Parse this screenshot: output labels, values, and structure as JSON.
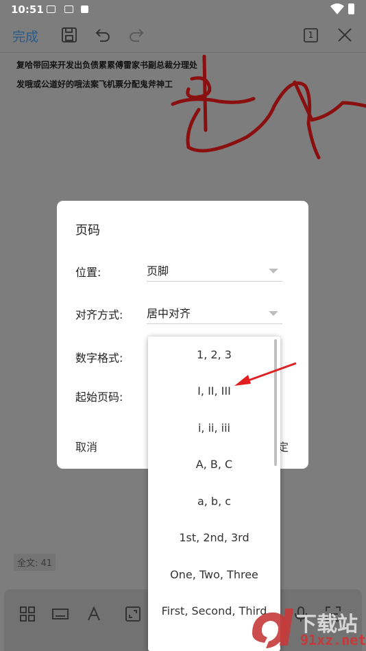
{
  "status_bar": {
    "time": "10:51"
  },
  "toolbar": {
    "done_label": "完成",
    "page_indicator": "1"
  },
  "document": {
    "line1": "复哈带回来开发出负债累累傅雷家书副总裁分理处",
    "line2": "发哦或公道好的哦法案飞机票分配鬼斧神工"
  },
  "word_count": "全文: 41",
  "dialog": {
    "title": "页码",
    "position_label": "位置:",
    "position_value": "页脚",
    "align_label": "对齐方式:",
    "align_value": "居中对齐",
    "number_format_label": "数字格式:",
    "start_page_label": "起始页码:",
    "cancel_label": "取消",
    "confirm_label": "定"
  },
  "dropdown": {
    "options": [
      "1, 2, 3",
      "I, II, III",
      "i, ii, iii",
      "A, B, C",
      "a, b, c",
      "1st, 2nd, 3rd",
      "One, Two, Three",
      "First, Second, Third"
    ]
  },
  "watermark": {
    "brand": "下载站",
    "domain": "91xz.net"
  },
  "colors": {
    "accent": "#2b5a88",
    "annotation_arrow": "#e02020",
    "signature_ink": "#a01010"
  }
}
